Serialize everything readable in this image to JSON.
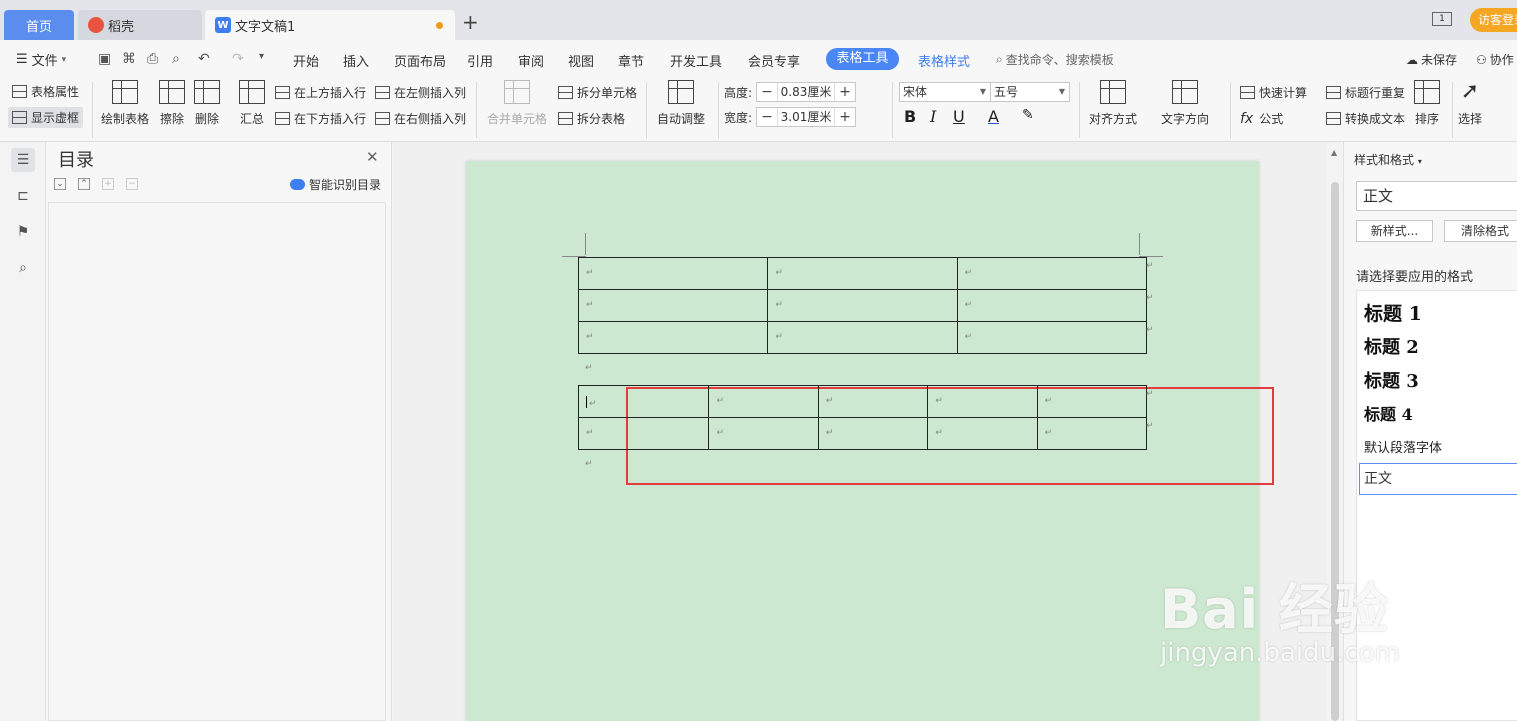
{
  "tabs": {
    "home": "首页",
    "daoke": "稻壳",
    "doc": "文字文稿1",
    "plus": "+",
    "visitor": "访客登录"
  },
  "menu": {
    "file": "文件",
    "items": [
      "开始",
      "插入",
      "页面布局",
      "引用",
      "审阅",
      "视图",
      "章节",
      "开发工具",
      "会员专享"
    ],
    "active": "表格工具",
    "table_style": "表格样式",
    "search": "查找命令、搜索模板",
    "unsaved": "未保存",
    "collab": "协作"
  },
  "ribbon": {
    "table_props": "表格属性",
    "show_gridlines": "显示虚框",
    "draw_table": "绘制表格",
    "erase": "擦除",
    "delete": "删除",
    "summary": "汇总",
    "insert_above": "在上方插入行",
    "insert_below": "在下方插入行",
    "insert_left": "在左侧插入列",
    "insert_right": "在右侧插入列",
    "merge_cells": "合并单元格",
    "split_cells": "拆分单元格",
    "split_table": "拆分表格",
    "auto_fit": "自动调整",
    "height_label": "高度:",
    "height_value": "0.83厘米",
    "width_label": "宽度:",
    "width_value": "3.01厘米",
    "font_name": "宋体",
    "font_size": "五号",
    "align": "对齐方式",
    "text_direction": "文字方向",
    "quick_calc": "快速计算",
    "formula": "公式",
    "repeat_header": "标题行重复",
    "to_text": "转换成文本",
    "sort": "排序",
    "select": "选择"
  },
  "toc": {
    "title": "目录",
    "smart": "智能识别目录"
  },
  "doc": {
    "para_mark": "↵",
    "table1": {
      "rows": 3,
      "cols": 3
    },
    "table2": {
      "rows": 2,
      "cols": 5
    }
  },
  "styles": {
    "title": "样式和格式",
    "current": "正文",
    "new_style": "新样式...",
    "clear_format": "清除格式",
    "prompt": "请选择要应用的格式",
    "heading1": "标题 1",
    "heading2": "标题 2",
    "heading3": "标题 3",
    "heading4": "标题 4",
    "default_font": "默认段落字体",
    "normal": "正文"
  },
  "watermark": {
    "main": "Bai 经验",
    "sub": "jingyan.baidu.com"
  },
  "colors": {
    "accent": "#4a86f5",
    "page": "#cde8d0",
    "highlight": "#e23c3c",
    "visitor": "#f5a623"
  }
}
